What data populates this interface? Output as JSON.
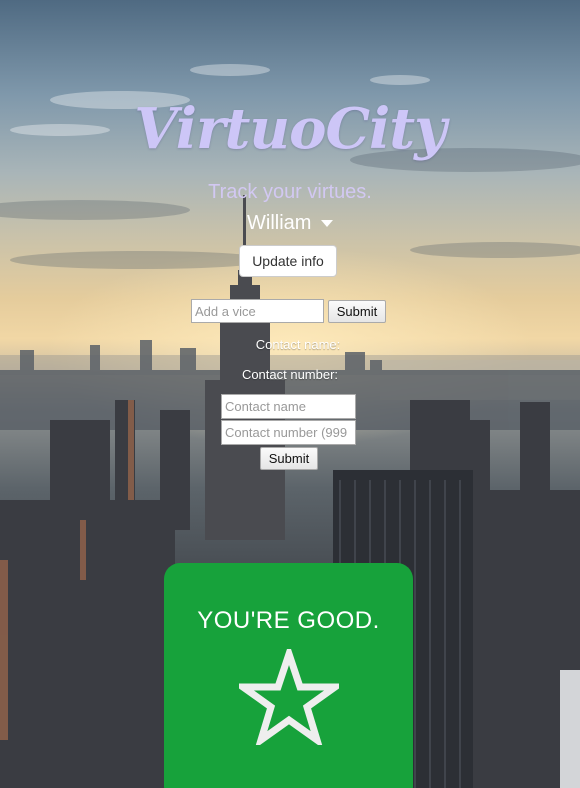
{
  "app": {
    "logo_text": "VirtuoCity",
    "tagline": "Track your virtues."
  },
  "user_menu": {
    "selected_user": "William",
    "caret_icon": "caret-down-icon"
  },
  "actions": {
    "update_info_label": "Update info"
  },
  "vice_form": {
    "placeholder": "Add a vice",
    "value": "",
    "submit_label": "Submit"
  },
  "contact_form": {
    "name_label": "Contact name:",
    "number_label": "Contact number:",
    "name_placeholder": "Contact name",
    "name_value": "",
    "number_placeholder": "Contact number (999",
    "number_value": "",
    "submit_label": "Submit"
  },
  "status": {
    "text": "YOU'RE GOOD.",
    "icon": "star-outline-icon",
    "card_color": "#17a23b"
  },
  "colors": {
    "logo": "#cdc6f7",
    "tagline": "#d2c8f2",
    "status_card": "#17a23b"
  }
}
